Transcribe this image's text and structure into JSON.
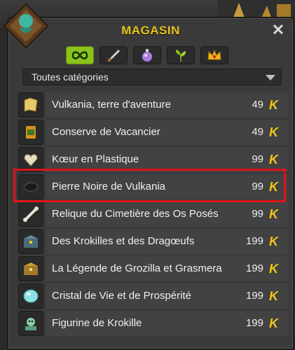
{
  "window": {
    "title": "MAGASIN",
    "close_label": "✕"
  },
  "tabs": [
    {
      "name": "tab-all",
      "icon": "infinity-icon",
      "active": true
    },
    {
      "name": "tab-equipment",
      "icon": "sword-icon",
      "active": false
    },
    {
      "name": "tab-consumables",
      "icon": "potion-icon",
      "active": false
    },
    {
      "name": "tab-resources",
      "icon": "leaf-icon",
      "active": false
    },
    {
      "name": "tab-cosmetics",
      "icon": "crown-icon",
      "active": false
    }
  ],
  "category_select": {
    "value": "Toutes catégories"
  },
  "items": [
    {
      "name": "Vulkania, terre d'aventure",
      "price": "49",
      "icon": "map-icon"
    },
    {
      "name": "Conserve de Vacancier",
      "price": "49",
      "icon": "can-icon"
    },
    {
      "name": "Kœur en Plastique",
      "price": "99",
      "icon": "toy-icon"
    },
    {
      "name": "Pierre Noire de Vulkania",
      "price": "99",
      "icon": "black-stone-icon"
    },
    {
      "name": "Relique du Cimetière des Os Posés",
      "price": "99",
      "icon": "bone-icon"
    },
    {
      "name": "Des Krokilles et des Dragœufs",
      "price": "199",
      "icon": "chest-icon"
    },
    {
      "name": "La Légende de Grozilla et Grasmera",
      "price": "199",
      "icon": "chest-gold-icon"
    },
    {
      "name": "Cristal de Vie et de Prospérité",
      "price": "199",
      "icon": "crystal-icon"
    },
    {
      "name": "Figurine de Krokille",
      "price": "199",
      "icon": "figurine-icon"
    }
  ],
  "currency_symbol": "K",
  "colors": {
    "title": "#e8c31a",
    "active_tab": "#8cc21c",
    "highlight": "#e0131a",
    "currency": "#f0c51a"
  }
}
